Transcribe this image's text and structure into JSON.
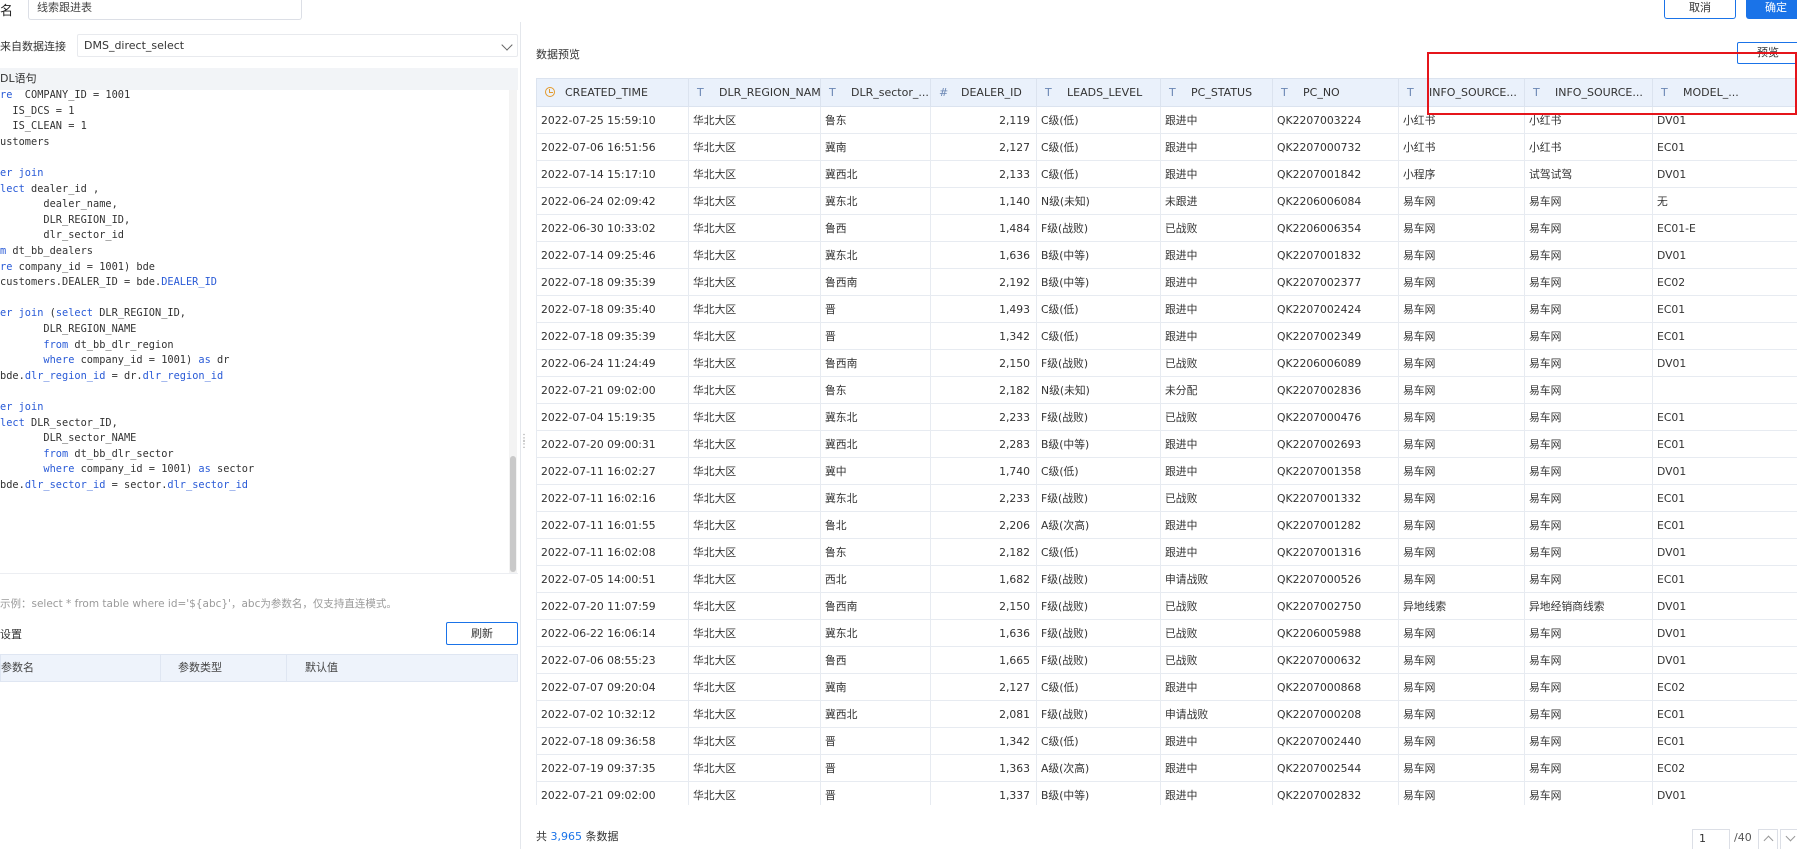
{
  "header": {
    "name_label": "名",
    "name_value": "线索跟进表",
    "cancel_label": "取消",
    "ok_label": "确定"
  },
  "left": {
    "connection_label": "来自数据连接",
    "connection_value": "DMS_direct_select",
    "sql_label": "DL语句",
    "example_text": "示例：select * from table where id='${abc}'，abc为参数名，仅支持直连模式。",
    "settings_title": "设置",
    "refresh_label": "刷新",
    "param_columns": [
      "参数名",
      "参数类型",
      "默认值"
    ]
  },
  "sql_lines": [
    [
      [
        "kw",
        "re"
      ],
      [
        "",
        "  COMPANY_ID = 1001"
      ]
    ],
    [
      [
        "",
        "  IS_DCS = 1"
      ]
    ],
    [
      [
        "",
        "  IS_CLEAN = 1"
      ]
    ],
    [
      [
        "",
        "ustomers"
      ]
    ],
    [
      [
        "",
        ""
      ]
    ],
    [
      [
        "kw",
        "er join"
      ]
    ],
    [
      [
        "kw",
        "lect"
      ],
      [
        "",
        " dealer_id ,"
      ]
    ],
    [
      [
        "",
        "       dealer_name,"
      ]
    ],
    [
      [
        "",
        "       DLR_REGION_ID,"
      ]
    ],
    [
      [
        "",
        "       dlr_sector_id"
      ]
    ],
    [
      [
        "kw",
        "m"
      ],
      [
        "",
        " dt_bb_dealers"
      ]
    ],
    [
      [
        "kw",
        "re"
      ],
      [
        "",
        " company_id = 1001) bde"
      ]
    ],
    [
      [
        "",
        "customers.DEALER_ID = bde."
      ],
      [
        "kw",
        "DEALER_ID"
      ]
    ],
    [
      [
        "",
        ""
      ]
    ],
    [
      [
        "kw",
        "er join"
      ],
      [
        "",
        " ("
      ],
      [
        "kw",
        "select"
      ],
      [
        "",
        " DLR_REGION_ID,"
      ]
    ],
    [
      [
        "",
        "       DLR_REGION_NAME"
      ]
    ],
    [
      [
        "kw",
        "       from"
      ],
      [
        "",
        " dt_bb_dlr_region"
      ]
    ],
    [
      [
        "kw",
        "       where"
      ],
      [
        "",
        " company_id = 1001) "
      ],
      [
        "kw",
        "as"
      ],
      [
        "",
        " dr"
      ]
    ],
    [
      [
        "",
        "bde."
      ],
      [
        "kw",
        "dlr_region_id"
      ],
      [
        "",
        " = dr."
      ],
      [
        "kw",
        "dlr_region_id"
      ]
    ],
    [
      [
        "",
        ""
      ]
    ],
    [
      [
        "kw",
        "er join"
      ]
    ],
    [
      [
        "kw",
        "lect"
      ],
      [
        "",
        " DLR_sector_ID,"
      ]
    ],
    [
      [
        "",
        "       DLR_sector_NAME"
      ]
    ],
    [
      [
        "kw",
        "       from"
      ],
      [
        "",
        " dt_bb_dlr_sector"
      ]
    ],
    [
      [
        "kw",
        "       where"
      ],
      [
        "",
        " company_id = 1001) "
      ],
      [
        "kw",
        "as"
      ],
      [
        "",
        " sector"
      ]
    ],
    [
      [
        "",
        "bde."
      ],
      [
        "kw",
        "dlr_sector_id"
      ],
      [
        "",
        " = sector."
      ],
      [
        "kw",
        "dlr_sector_id"
      ]
    ]
  ],
  "preview": {
    "title": "数据预览",
    "preview_button": "预览",
    "columns": [
      {
        "name": "CREATED_TIME",
        "icon": "clock"
      },
      {
        "name": "DLR_REGION_NAME",
        "icon": "T"
      },
      {
        "name": "DLR_sector_...",
        "icon": "T"
      },
      {
        "name": "DEALER_ID",
        "icon": "#"
      },
      {
        "name": "LEADS_LEVEL",
        "icon": "T"
      },
      {
        "name": "PC_STATUS",
        "icon": "T"
      },
      {
        "name": "PC_NO",
        "icon": "T"
      },
      {
        "name": "INFO_SOURCE...",
        "icon": "T"
      },
      {
        "name": "INFO_SOURCE...",
        "icon": "T"
      },
      {
        "name": "MODEL_...",
        "icon": "T"
      }
    ],
    "rows": [
      [
        "2022-07-25 15:59:10",
        "华北大区",
        "鲁东",
        "2,119",
        "C级(低)",
        "跟进中",
        "QK2207003224",
        "小红书",
        "小红书",
        "DV01"
      ],
      [
        "2022-07-06 16:51:56",
        "华北大区",
        "冀南",
        "2,127",
        "C级(低)",
        "跟进中",
        "QK2207000732",
        "小红书",
        "小红书",
        "EC01"
      ],
      [
        "2022-07-14 15:17:10",
        "华北大区",
        "冀西北",
        "2,133",
        "C级(低)",
        "跟进中",
        "QK2207001842",
        "小程序",
        "试驾试驾",
        "DV01"
      ],
      [
        "2022-06-24 02:09:42",
        "华北大区",
        "冀东北",
        "1,140",
        "N级(未知)",
        "未跟进",
        "QK2206006084",
        "易车网",
        "易车网",
        "无"
      ],
      [
        "2022-06-30 10:33:02",
        "华北大区",
        "鲁西",
        "1,484",
        "F级(战败)",
        "已战败",
        "QK2206006354",
        "易车网",
        "易车网",
        "EC01-E"
      ],
      [
        "2022-07-14 09:25:46",
        "华北大区",
        "冀东北",
        "1,636",
        "B级(中等)",
        "跟进中",
        "QK2207001832",
        "易车网",
        "易车网",
        "DV01"
      ],
      [
        "2022-07-18 09:35:39",
        "华北大区",
        "鲁西南",
        "2,192",
        "B级(中等)",
        "跟进中",
        "QK2207002377",
        "易车网",
        "易车网",
        "EC02"
      ],
      [
        "2022-07-18 09:35:40",
        "华北大区",
        "晋",
        "1,493",
        "C级(低)",
        "跟进中",
        "QK2207002424",
        "易车网",
        "易车网",
        "EC01"
      ],
      [
        "2022-07-18 09:35:39",
        "华北大区",
        "晋",
        "1,342",
        "C级(低)",
        "跟进中",
        "QK2207002349",
        "易车网",
        "易车网",
        "EC01"
      ],
      [
        "2022-06-24 11:24:49",
        "华北大区",
        "鲁西南",
        "2,150",
        "F级(战败)",
        "已战败",
        "QK2206006089",
        "易车网",
        "易车网",
        "DV01"
      ],
      [
        "2022-07-21 09:02:00",
        "华北大区",
        "鲁东",
        "2,182",
        "N级(未知)",
        "未分配",
        "QK2207002836",
        "易车网",
        "易车网",
        ""
      ],
      [
        "2022-07-04 15:19:35",
        "华北大区",
        "冀东北",
        "2,233",
        "F级(战败)",
        "已战败",
        "QK2207000476",
        "易车网",
        "易车网",
        "EC01"
      ],
      [
        "2022-07-20 09:00:31",
        "华北大区",
        "冀西北",
        "2,283",
        "B级(中等)",
        "跟进中",
        "QK2207002693",
        "易车网",
        "易车网",
        "EC01"
      ],
      [
        "2022-07-11 16:02:27",
        "华北大区",
        "冀中",
        "1,740",
        "C级(低)",
        "跟进中",
        "QK2207001358",
        "易车网",
        "易车网",
        "DV01"
      ],
      [
        "2022-07-11 16:02:16",
        "华北大区",
        "冀东北",
        "2,233",
        "F级(战败)",
        "已战败",
        "QK2207001332",
        "易车网",
        "易车网",
        "EC01"
      ],
      [
        "2022-07-11 16:01:55",
        "华北大区",
        "鲁北",
        "2,206",
        "A级(次高)",
        "跟进中",
        "QK2207001282",
        "易车网",
        "易车网",
        "EC01"
      ],
      [
        "2022-07-11 16:02:08",
        "华北大区",
        "鲁东",
        "2,182",
        "C级(低)",
        "跟进中",
        "QK2207001316",
        "易车网",
        "易车网",
        "DV01"
      ],
      [
        "2022-07-05 14:00:51",
        "华北大区",
        "西北",
        "1,682",
        "F级(战败)",
        "申请战败",
        "QK2207000526",
        "易车网",
        "易车网",
        "EC01"
      ],
      [
        "2022-07-20 11:07:59",
        "华北大区",
        "鲁西南",
        "2,150",
        "F级(战败)",
        "已战败",
        "QK2207002750",
        "异地线索",
        "异地经销商线索",
        "DV01"
      ],
      [
        "2022-06-22 16:06:14",
        "华北大区",
        "冀东北",
        "1,636",
        "F级(战败)",
        "已战败",
        "QK2206005988",
        "易车网",
        "易车网",
        "DV01"
      ],
      [
        "2022-07-06 08:55:23",
        "华北大区",
        "鲁西",
        "1,665",
        "F级(战败)",
        "已战败",
        "QK2207000632",
        "易车网",
        "易车网",
        "DV01"
      ],
      [
        "2022-07-07 09:20:04",
        "华北大区",
        "冀南",
        "2,127",
        "C级(低)",
        "跟进中",
        "QK2207000868",
        "易车网",
        "易车网",
        "EC02"
      ],
      [
        "2022-07-02 10:32:12",
        "华北大区",
        "冀西北",
        "2,081",
        "F级(战败)",
        "申请战败",
        "QK2207000208",
        "易车网",
        "易车网",
        "EC01"
      ],
      [
        "2022-07-18 09:36:58",
        "华北大区",
        "晋",
        "1,342",
        "C级(低)",
        "跟进中",
        "QK2207002440",
        "易车网",
        "易车网",
        "EC01"
      ],
      [
        "2022-07-19 09:37:35",
        "华北大区",
        "晋",
        "1,363",
        "A级(次高)",
        "跟进中",
        "QK2207002544",
        "易车网",
        "易车网",
        "EC02"
      ],
      [
        "2022-07-21 09:02:00",
        "华北大区",
        "晋",
        "1,337",
        "B级(中等)",
        "跟进中",
        "QK2207002832",
        "易车网",
        "易车网",
        "DV01"
      ]
    ]
  },
  "footer": {
    "prefix": "共",
    "count": "3,965",
    "suffix": "条数据",
    "page_current": "1",
    "page_total": "/40"
  },
  "colors": {
    "accent": "#1a73e8",
    "highlight_box": "#e5151b",
    "header_bg": "#eaf1fb"
  }
}
